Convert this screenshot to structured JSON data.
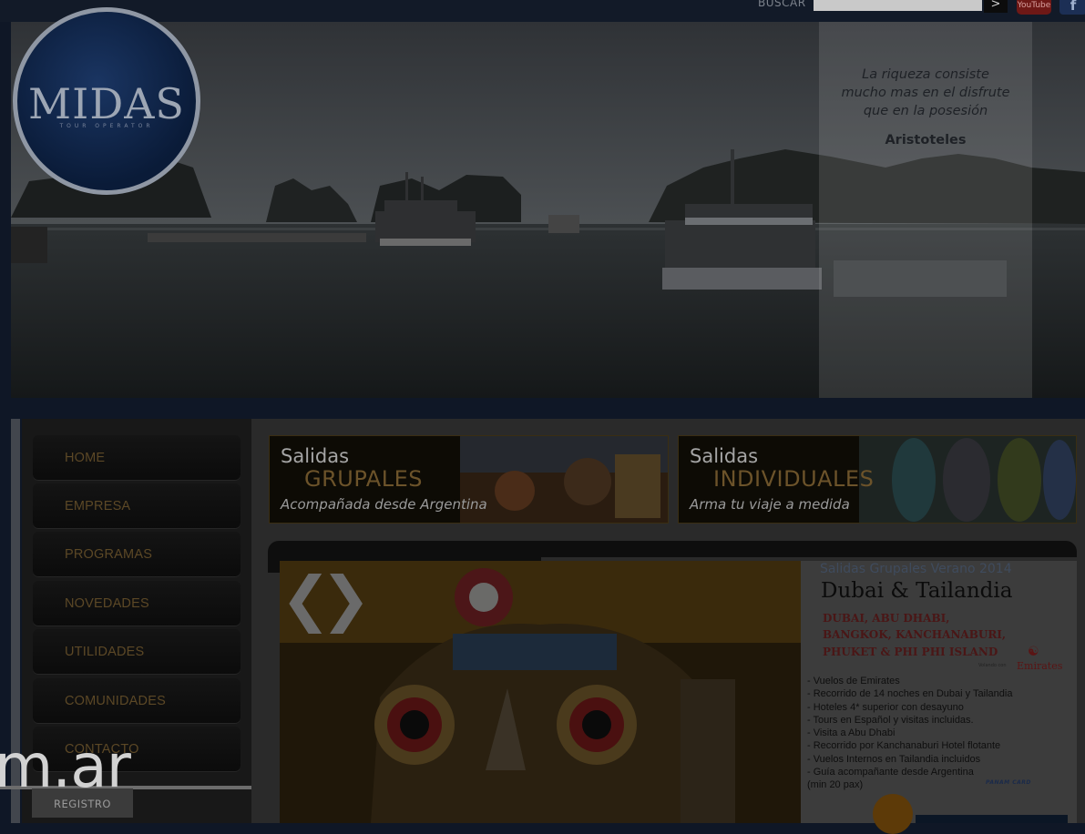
{
  "header": {
    "search_label": "BUSCAR",
    "search_value": "",
    "search_button": ">",
    "youtube_label": "YouTube",
    "facebook_label": "f"
  },
  "logo": {
    "name": "MIDAS",
    "subtitle": "TOUR OPERATOR"
  },
  "hero": {
    "quote": [
      "La riqueza consiste",
      "mucho mas en el disfrute",
      "que en la posesión"
    ],
    "author": "Aristoteles"
  },
  "nav": {
    "items": [
      {
        "label": "HOME"
      },
      {
        "label": "EMPRESA"
      },
      {
        "label": "PROGRAMAS"
      },
      {
        "label": "NOVEDADES"
      },
      {
        "label": "UTILIDADES"
      },
      {
        "label": "COMUNIDADES"
      },
      {
        "label": "CONTACTO"
      }
    ],
    "registro": "REGISTRO",
    "domain_fragment": "m.ar"
  },
  "banners": [
    {
      "line1": "Salidas",
      "line2": "GRUPALES",
      "line3": "Acompañada desde Argentina"
    },
    {
      "line1": "Salidas",
      "line2": "INDIVIDUALES",
      "line3": "Arma tu viaje a medida"
    }
  ],
  "slider": {
    "prev": "❮",
    "next": "❯"
  },
  "promo": {
    "eyebrow": "Salidas Grupales Verano 2014",
    "title": "Dubai & Tailandia",
    "destinations": [
      "DUBAI, ABU DHABI,",
      "BANGKOK, KANCHANABURI,",
      "PHUKET & PHI PHI ISLAND"
    ],
    "airline": "Emirates",
    "airline_prefix": "Volando con",
    "features": [
      "-  Vuelos de Emirates",
      "-  Recorrido de 14 noches en Dubai y Tailandia",
      "-  Hoteles 4* superior con desayuno",
      "-  Tours en Español y visitas incluidas.",
      "-  Visita a Abu Dhabi",
      "-  Recorrido por Kanchanaburi Hotel flotante",
      "-  Vuelos Internos en Tailandia incluidos",
      "- Guía acompañante desde Argentina",
      " (min 20 pax)"
    ],
    "partner": "PANAM CARD"
  },
  "colors": {
    "nav_text": "#5c4826",
    "accent_gold": "#6c532a",
    "promo_dest": "#4a1616"
  }
}
